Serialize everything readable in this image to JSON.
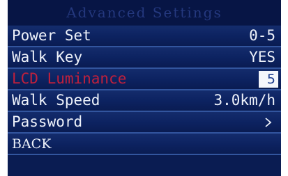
{
  "screen": {
    "title": "Advanced Settings"
  },
  "menu": {
    "items": [
      {
        "label": "Power Set",
        "value": "0-5"
      },
      {
        "label": "Walk Key",
        "value": "YES"
      },
      {
        "label": "LCD Luminance",
        "value": "5"
      },
      {
        "label": "Walk Speed",
        "value": "3.0km/h"
      },
      {
        "label": "Password",
        "value": ""
      },
      {
        "label": "BACK",
        "value": ""
      }
    ],
    "selected_item": "LCD Luminance"
  },
  "icons": {
    "password_arrow": "chevron-right-icon"
  },
  "colors": {
    "background": "#0a1c52",
    "text": "#eef2fa",
    "selected_label": "#c0203c",
    "title_text": "#24387e",
    "row_divider": "#32559e",
    "value_box_bg": "#f4f6fb"
  }
}
